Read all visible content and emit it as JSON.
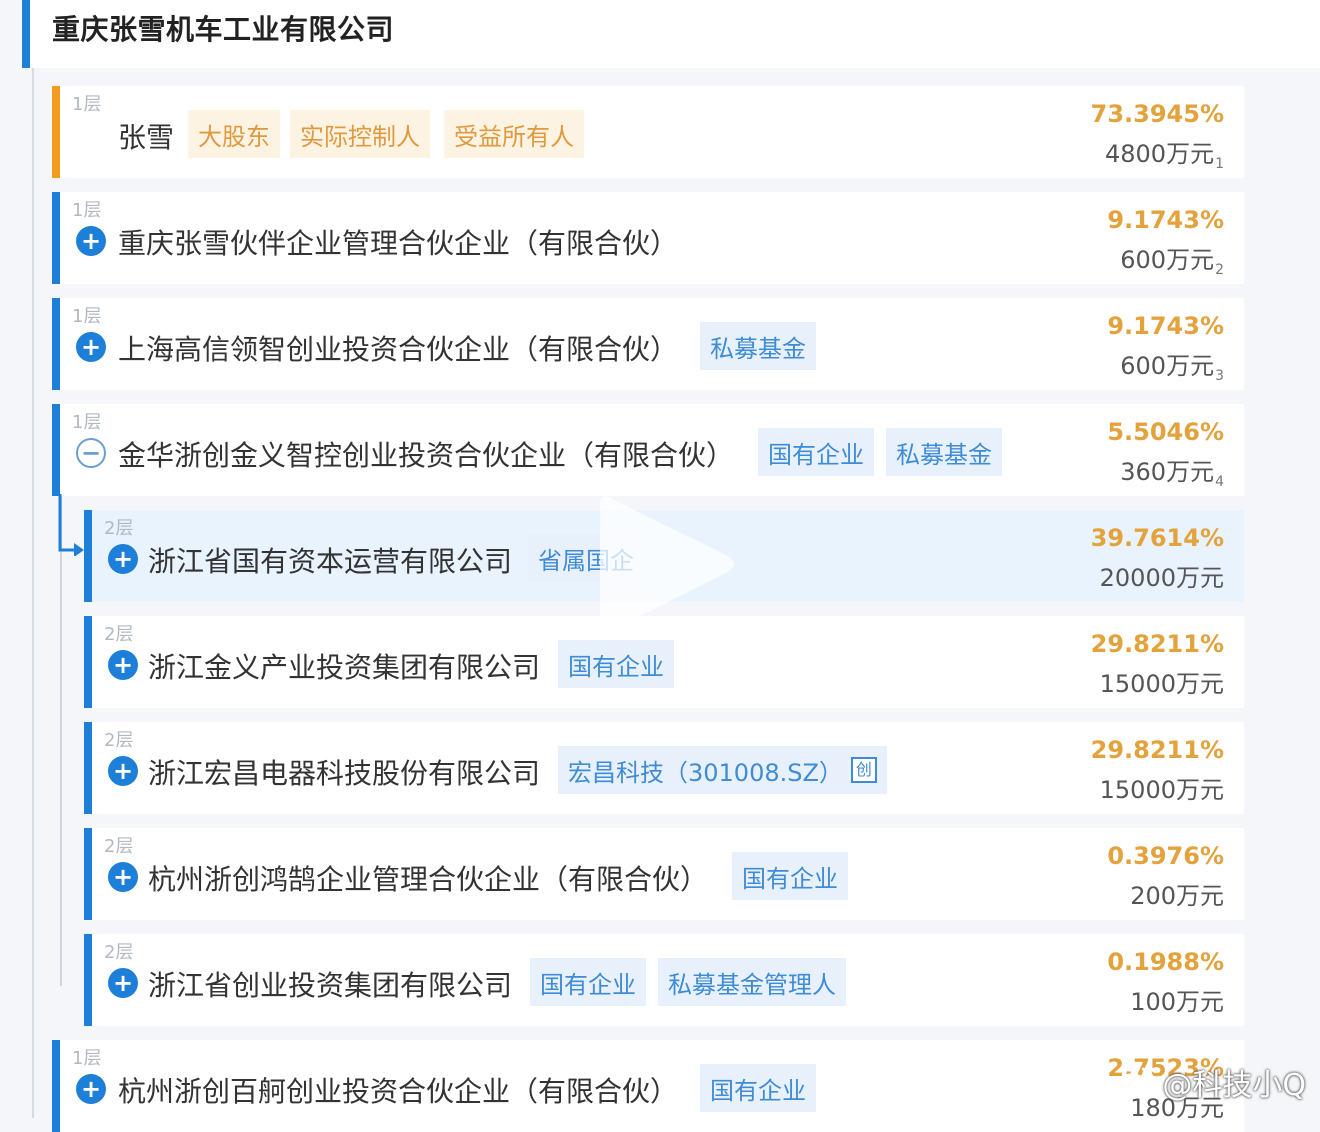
{
  "company": {
    "title": "重庆张雪机车工业有限公司"
  },
  "shareholders": [
    {
      "layer": "1层",
      "name": "张雪",
      "tags": [
        "大股东",
        "实际控制人",
        "受益所有人"
      ],
      "percent": "73.3945%",
      "amount": "4800万元",
      "index": "1"
    },
    {
      "layer": "1层",
      "name": "重庆张雪伙伴企业管理合伙企业（有限合伙）",
      "tags": [],
      "percent": "9.1743%",
      "amount": "600万元",
      "index": "2"
    },
    {
      "layer": "1层",
      "name": "上海高信领智创业投资合伙企业（有限合伙）",
      "tags": [
        "私募基金"
      ],
      "percent": "9.1743%",
      "amount": "600万元",
      "index": "3"
    },
    {
      "layer": "1层",
      "name": "金华浙创金义智控创业投资合伙企业（有限合伙）",
      "tags": [
        "国有企业",
        "私募基金"
      ],
      "percent": "5.5046%",
      "amount": "360万元",
      "index": "4"
    },
    {
      "layer": "1层",
      "name": "杭州浙创百舸创业投资合伙企业（有限合伙）",
      "tags": [
        "国有企业"
      ],
      "percent": "2.7523%",
      "amount": "180万元",
      "index": ""
    }
  ],
  "sub_shareholders": [
    {
      "layer": "2层",
      "name": "浙江省国有资本运营有限公司",
      "tags": [
        "省属国企"
      ],
      "percent": "39.7614%",
      "amount": "20000万元"
    },
    {
      "layer": "2层",
      "name": "浙江金义产业投资集团有限公司",
      "tags": [
        "国有企业"
      ],
      "percent": "29.8211%",
      "amount": "15000万元"
    },
    {
      "layer": "2层",
      "name": "浙江宏昌电器科技股份有限公司",
      "tags": [
        "宏昌科技（301008.SZ）"
      ],
      "stock_badge": "创",
      "percent": "29.8211%",
      "amount": "15000万元"
    },
    {
      "layer": "2层",
      "name": "杭州浙创鸿鹄企业管理合伙企业（有限合伙）",
      "tags": [
        "国有企业"
      ],
      "percent": "0.3976%",
      "amount": "200万元"
    },
    {
      "layer": "2层",
      "name": "浙江省创业投资集团有限公司",
      "tags": [
        "国有企业",
        "私募基金管理人"
      ],
      "percent": "0.1988%",
      "amount": "100万元"
    }
  ],
  "watermark": {
    "text": "@科技小Q"
  },
  "colors": {
    "accent": "#1e7fd8",
    "gold": "#f29b1d",
    "percent": "#e3a23c",
    "tag_blue": "#3e8bd6",
    "tag_orange": "#e09a3d"
  },
  "icons": {
    "expand": "plus-circle-icon",
    "collapse": "minus-circle-icon",
    "video": "play-icon",
    "watermark": "weibo-icon"
  }
}
